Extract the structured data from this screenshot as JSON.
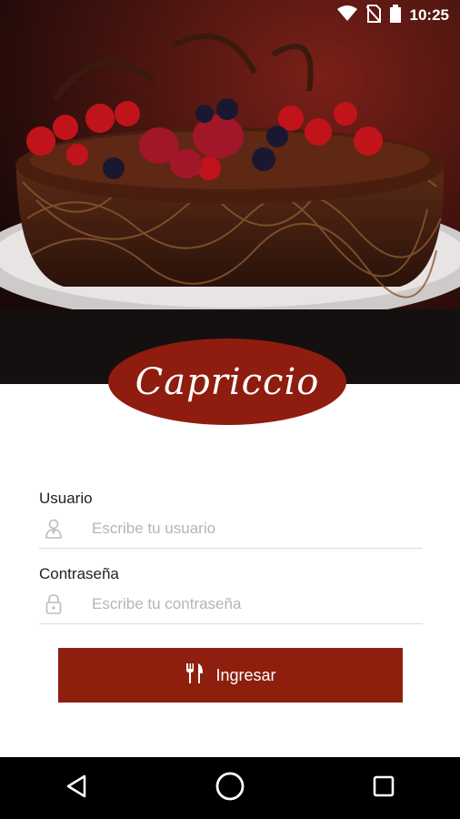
{
  "status_bar": {
    "time": "10:25"
  },
  "brand": {
    "name": "Capriccio",
    "color": "#8e1c0f"
  },
  "hero": {
    "image": "chocolate-cake-with-berries"
  },
  "form": {
    "username": {
      "label": "Usuario",
      "placeholder": "Escribe tu usuario",
      "value": ""
    },
    "password": {
      "label": "Contraseña",
      "placeholder": "Escribe tu contraseña",
      "value": ""
    }
  },
  "login_button": {
    "label": "Ingresar",
    "icon": "cutlery-icon"
  },
  "nav": {
    "back": "back-icon",
    "home": "home-icon",
    "recents": "recents-icon"
  }
}
